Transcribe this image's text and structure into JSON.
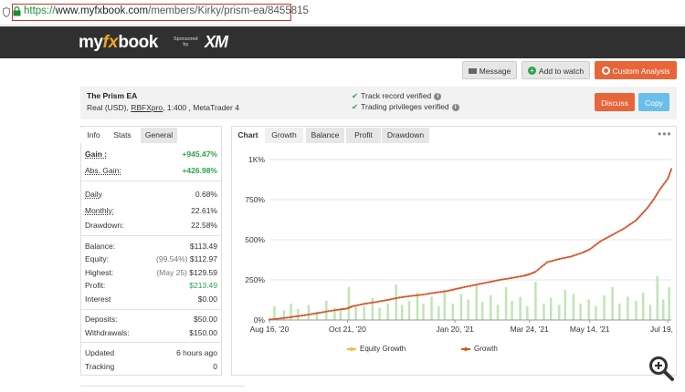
{
  "browser": {
    "url_scheme": "https://",
    "url_host": "www.myfxbook.com",
    "url_path": "/members/Kirky/prism-ea/8455815"
  },
  "header": {
    "logo_my": "my",
    "logo_fx": "fx",
    "logo_book": "book",
    "sponsored_line1": "Sponsored",
    "sponsored_line2": "by",
    "sponsor": "XM"
  },
  "actions": {
    "message": "Message",
    "add_to_watch": "Add to watch",
    "custom_analysis": "Custom Analysis",
    "discuss": "Discuss",
    "copy": "Copy"
  },
  "account": {
    "name": "The Prism EA",
    "sub_prefix": "Real (USD),",
    "broker": "RBFXpro",
    "sub_suffix": ", 1:400 , MetaTrader 4",
    "verified_track": "Track record verified",
    "verified_privileges": "Trading privileges verified"
  },
  "left_tabs": [
    "Info",
    "Stats",
    "General"
  ],
  "stats": {
    "gain_label": "Gain :",
    "gain_value": "+945.47%",
    "abs_gain_label": "Abs. Gain:",
    "abs_gain_value": "+426.98%",
    "daily_label": "Daily",
    "daily_value": "0.68%",
    "monthly_label": "Monthly:",
    "monthly_value": "22.61%",
    "drawdown_label": "Drawdown:",
    "drawdown_value": "22.58%",
    "balance_label": "Balance:",
    "balance_value": "$113.49",
    "equity_label": "Equity:",
    "equity_pct": "(99.54%)",
    "equity_value": "$112.97",
    "highest_label": "Highest:",
    "highest_date": "(May 25)",
    "highest_value": "$129.59",
    "profit_label": "Profit:",
    "profit_value": "$213.49",
    "interest_label": "Interest",
    "interest_value": "$0.00",
    "deposits_label": "Deposits:",
    "deposits_value": "$50.00",
    "withdrawals_label": "Withdrawals:",
    "withdrawals_value": "$150.00",
    "updated_label": "Updated",
    "updated_value": "6 hours ago",
    "tracking_label": "Tracking",
    "tracking_value": "0"
  },
  "chart_tabs": [
    "Chart",
    "Growth",
    "Balance",
    "Profit",
    "Drawdown"
  ],
  "more": "•••",
  "colors": {
    "growth_line": "#d9532c",
    "equity_line": "#f5b942",
    "bars": "#bfe6b3",
    "orange_btn": "#e8653a",
    "blue_btn": "#69bfe8",
    "green": "#2ea34a"
  },
  "chart_data": {
    "type": "line",
    "ytick_labels": [
      "0%",
      "250%",
      "500%",
      "750%",
      "1K%"
    ],
    "yticks": [
      0,
      250,
      500,
      750,
      1000
    ],
    "ylim": [
      0,
      1000
    ],
    "xtick_labels": [
      "Aug 16, '20",
      "Oct 21, '20",
      "Jan 20, '21",
      "Mar 24, '21",
      "May 14, '21",
      "Jul 19, '21"
    ],
    "xtick_positions": [
      0,
      66,
      157,
      220,
      271,
      337
    ],
    "xlim": [
      0,
      340
    ],
    "series": [
      {
        "name": "Growth",
        "x": [
          0,
          10,
          20,
          30,
          40,
          50,
          60,
          66,
          70,
          80,
          90,
          100,
          110,
          120,
          130,
          140,
          150,
          157,
          165,
          175,
          185,
          195,
          205,
          215,
          220,
          225,
          235,
          245,
          255,
          265,
          271,
          280,
          290,
          300,
          310,
          315,
          320,
          325,
          330,
          337,
          340
        ],
        "y": [
          3,
          10,
          20,
          30,
          42,
          55,
          66,
          72,
          85,
          100,
          112,
          125,
          140,
          150,
          158,
          170,
          180,
          192,
          205,
          220,
          235,
          250,
          262,
          275,
          285,
          300,
          360,
          380,
          395,
          420,
          440,
          490,
          530,
          570,
          620,
          660,
          700,
          750,
          810,
          880,
          940
        ]
      },
      {
        "name": "Equity Growth",
        "x": [],
        "y": []
      }
    ],
    "bars": {
      "x": [
        4,
        12,
        18,
        24,
        33,
        40,
        48,
        55,
        60,
        67,
        73,
        80,
        87,
        93,
        100,
        107,
        112,
        118,
        125,
        130,
        137,
        143,
        148,
        155,
        162,
        168,
        175,
        180,
        187,
        193,
        200,
        205,
        212,
        218,
        225,
        232,
        238,
        245,
        250,
        257,
        263,
        270,
        276,
        283,
        290,
        296,
        303,
        310,
        316,
        322,
        328,
        333,
        338
      ],
      "y": [
        50,
        35,
        60,
        40,
        55,
        30,
        70,
        45,
        40,
        120,
        55,
        50,
        80,
        45,
        60,
        130,
        55,
        70,
        100,
        60,
        85,
        50,
        110,
        60,
        95,
        75,
        130,
        65,
        90,
        55,
        120,
        70,
        85,
        50,
        140,
        60,
        80,
        55,
        110,
        95,
        60,
        75,
        50,
        90,
        120,
        60,
        85,
        70,
        100,
        55,
        160,
        75,
        120
      ]
    },
    "legend": [
      "Equity Growth",
      "Growth"
    ],
    "legend_placement": "bottom"
  }
}
